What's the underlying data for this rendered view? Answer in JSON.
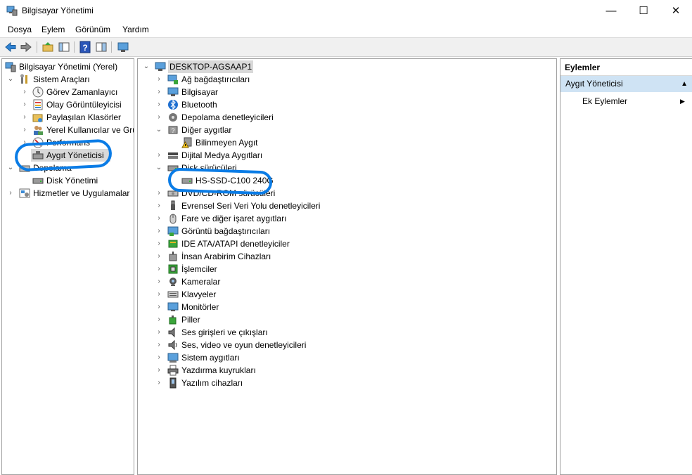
{
  "window": {
    "title": "Bilgisayar Yönetimi",
    "controls": {
      "minimize": "—",
      "maximize": "☐",
      "close": "✕"
    }
  },
  "menu": [
    "Dosya",
    "Eylem",
    "Görünüm",
    "Yardım"
  ],
  "toolbar": [
    "back-arrow-icon",
    "forward-arrow-icon",
    "up-folder-icon",
    "show-hide-console-tree-icon",
    "help-icon",
    "properties-pane-icon",
    "monitor-icon"
  ],
  "left_tree": {
    "root": "Bilgisayar Yönetimi (Yerel)",
    "system_tools": "Sistem Araçları",
    "task_scheduler": "Görev Zamanlayıcı",
    "event_viewer": "Olay Görüntüleyicisi",
    "shared_folders": "Paylaşılan Klasörler",
    "local_users": "Yerel Kullanıcılar ve Gru",
    "performance": "Performans",
    "device_manager": "Aygıt Yöneticisi",
    "storage": "Depolama",
    "disk_management": "Disk Yönetimi",
    "services": "Hizmetler ve Uygulamalar"
  },
  "device_tree": {
    "computer_name": "DESKTOP-AGSAAP1",
    "categories": [
      "Ağ bağdaştırıcıları",
      "Bilgisayar",
      "Bluetooth",
      "Depolama denetleyicileri",
      "Diğer aygıtlar",
      "Bilinmeyen Aygıt",
      "Dijital Medya Aygıtları",
      "Disk sürücüleri",
      "HS-SSD-C100 240G",
      "DVD/CD-ROM sürücüleri",
      "Evrensel Seri Veri Yolu denetleyicileri",
      "Fare ve diğer işaret aygıtları",
      "Görüntü bağdaştırıcıları",
      "IDE ATA/ATAPI denetleyiciler",
      "İnsan Arabirim Cihazları",
      "İşlemciler",
      "Kameralar",
      "Klavyeler",
      "Monitörler",
      "Piller",
      "Ses girişleri ve çıkışları",
      "Ses, video ve oyun denetleyicileri",
      "Sistem aygıtları",
      "Yazdırma kuyrukları",
      "Yazılım cihazları"
    ]
  },
  "actions": {
    "header": "Eylemler",
    "section": "Aygıt Yöneticisi",
    "more": "Ek Eylemler"
  },
  "colors": {
    "highlight_ink": "#0a7ce6",
    "actions_section_bg": "#cfe3f4",
    "selected_bg": "#d9d9d9"
  }
}
